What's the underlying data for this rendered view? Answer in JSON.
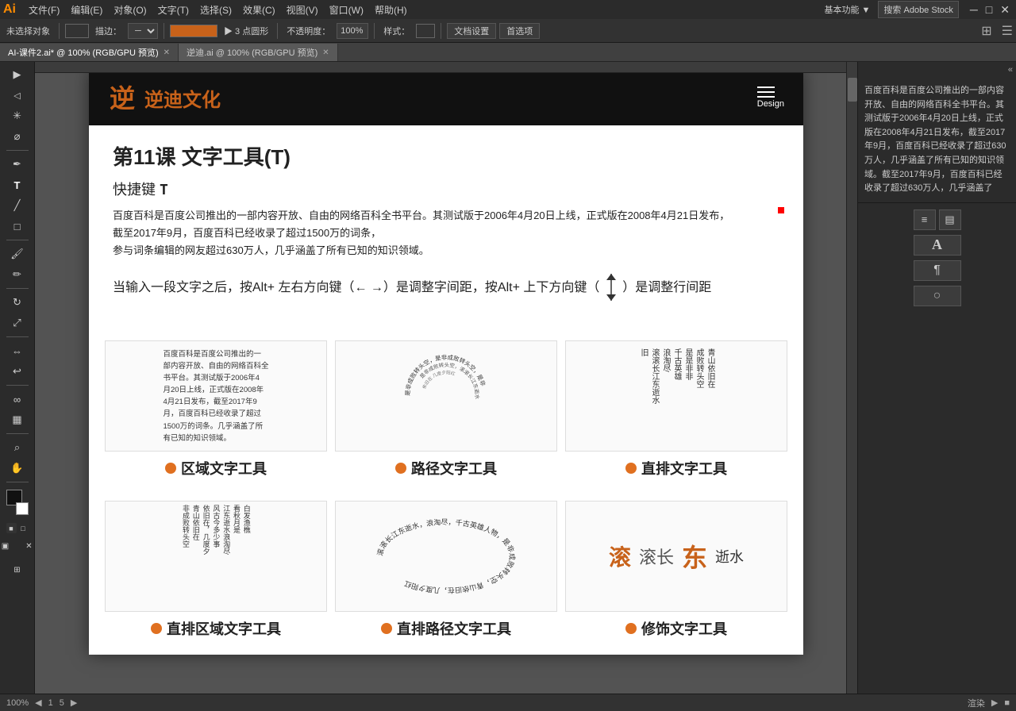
{
  "app": {
    "logo": "Ai",
    "title_color": "#ff8c00"
  },
  "menubar": {
    "items": [
      "文件(F)",
      "编辑(E)",
      "对象(O)",
      "文字(T)",
      "选择(S)",
      "效果(C)",
      "视图(V)",
      "窗口(W)",
      "帮助(H)"
    ]
  },
  "toolbar": {
    "no_selection": "未选择对象",
    "blend_label": "描边：",
    "point_label": "▶ 3 点圆形",
    "opacity_label": "不透明度：",
    "opacity_value": "100%",
    "style_label": "样式：",
    "doc_settings": "文档设置",
    "preferences": "首选项"
  },
  "tabs": [
    {
      "label": "AI-课件2.ai* @ 100% (RGB/GPU 预览)",
      "active": true
    },
    {
      "label": "逆迪.ai @ 100% (RGB/GPU 预览)",
      "active": false
    }
  ],
  "artboard": {
    "header": {
      "logo": "逆迪文化",
      "menu_label": "Design"
    },
    "lesson": {
      "title": "第11课   文字工具(T)",
      "shortcut": "快捷键 T",
      "description_lines": [
        "百度百科是百度公司推出的一部内容开放、自由的网络百科全书平台。其测试版于2006年4月20日上线，正式版在2008年4月21日发布，",
        "截至2017年9月，百度百科已经收录了超过1500万的词条，",
        "参与词条编辑的网友超过630万人，几乎涵盖了所有已知的知识领域。"
      ],
      "arrow_instruction": "当输入一段文字之后，按Alt+ 左右方向键（← →）是调整字间距，按Alt+ 上下方向键（↑↓）是调整行间距"
    },
    "tools": [
      {
        "label": "区域文字工具",
        "demo_type": "area"
      },
      {
        "label": "路径文字工具",
        "demo_type": "path_circle"
      },
      {
        "label": "直排文字工具",
        "demo_type": "vertical"
      }
    ],
    "tools_bottom": [
      {
        "label": "直排区域文字工具",
        "demo_type": "vertical_area"
      },
      {
        "label": "直排路径文字工具",
        "demo_type": "vertical_path"
      },
      {
        "label": "修饰文字工具",
        "demo_type": "decorative"
      }
    ]
  },
  "right_panel": {
    "text": "百度百科是百度公司推出的一部内容开放、自由的网络百科全书平台。其测试版于2006年4月20日上线，正式版在2008年4月21日发布，截至2017年9月，百度百科已经收录了超过630万人，几乎涵盖了所有已知的知识领域。截至2017年9月，百度百科已经收录了超过630万人，几乎涵盖了"
  },
  "bottom_bar": {
    "zoom": "100%",
    "page": "1",
    "of": "5",
    "info": "渲染"
  }
}
